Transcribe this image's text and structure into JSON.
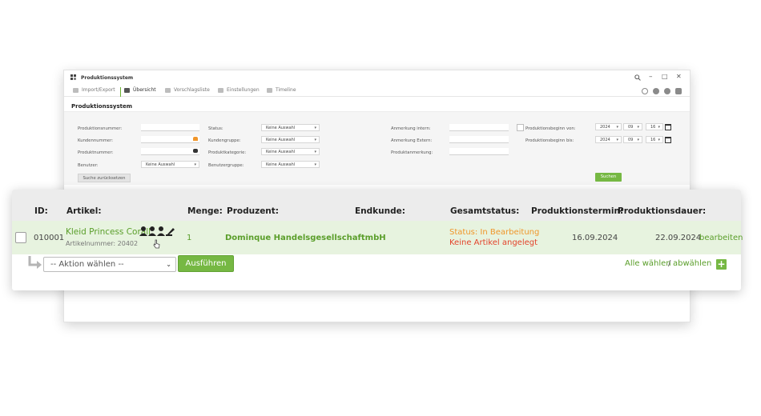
{
  "window": {
    "title": "Produktionssystem",
    "controls": [
      "–",
      "□",
      "✕"
    ],
    "tabs": [
      {
        "label": "Import/Export",
        "icon": "import-export-icon"
      },
      {
        "label": "Übersicht",
        "icon": "table-icon",
        "active": true
      },
      {
        "label": "Vorschlagsliste",
        "icon": "list-icon"
      },
      {
        "label": "Einstellungen",
        "icon": "settings-icon"
      },
      {
        "label": "Timeline",
        "icon": "timeline-icon"
      }
    ],
    "page_title": "Produktionssystem"
  },
  "filters": {
    "produktionsnummer": "Produktionsnummer:",
    "kundennummer": "Kundennummer:",
    "produktnummer": "Produktnummer:",
    "benutzer": "Benutzer:",
    "benutzer_value": "Keine Auswahl",
    "status": "Status:",
    "status_value": "Keine Auswahl",
    "kundengruppe": "Kundengruppe:",
    "kundengruppe_value": "Keine Auswahl",
    "produktkategorie": "Produktkategorie:",
    "produktkategorie_value": "Keine Auswahl",
    "benutzergruppe": "Benutzergruppe:",
    "benutzergruppe_value": "Keine Auswahl",
    "anmerkung_intern": "Anmerkung intern:",
    "anmerkung_extern": "Anmerkung Extern:",
    "produktanmerkung": "Produktanmerkung:",
    "beginn_von": "Produktionsbeginn von:",
    "beginn_bis": "Produktionsbeginn bis:",
    "von_year": "2024",
    "von_month": "09",
    "von_day": "16",
    "bis_year": "2024",
    "bis_month": "09",
    "bis_day": "16",
    "reset_label": "Suche zurücksetzen",
    "search_label": "Suchen"
  },
  "table": {
    "headers": {
      "id": "ID:",
      "artikel": "Artikel:",
      "menge": "Menge:",
      "produzent": "Produzent:",
      "endkunde": "Endkunde:",
      "gesamtstatus": "Gesamtstatus:",
      "termin": "Produktionstermin:",
      "dauer": "Produktionsdauer:"
    },
    "row": {
      "id": "010001",
      "artikel_name": "Kleid Princess Corall",
      "artikel_nummer": "Artikelnummer: 20402",
      "menge": "1",
      "produzent": "Dominque HandelsgesellschaftmbH",
      "endkunde": "",
      "status_line1": "Status: In Bearbeitung",
      "status_line2": "Keine Artikel angelegt",
      "termin": "16.09.2024",
      "dauer": "22.09.2024",
      "edit_label": "bearbeiten"
    }
  },
  "actions": {
    "select_placeholder": "-- Aktion wählen --",
    "execute_label": "Ausführen",
    "select_all": "Alle wählen",
    "separator": "/",
    "deselect_all": "abwählen",
    "add_label": "+"
  },
  "colors": {
    "accent_green": "#76b843",
    "link_green": "#5a9e2a",
    "row_highlight": "#e7f3df",
    "status_orange": "#f0962a",
    "status_red": "#e3432b"
  }
}
